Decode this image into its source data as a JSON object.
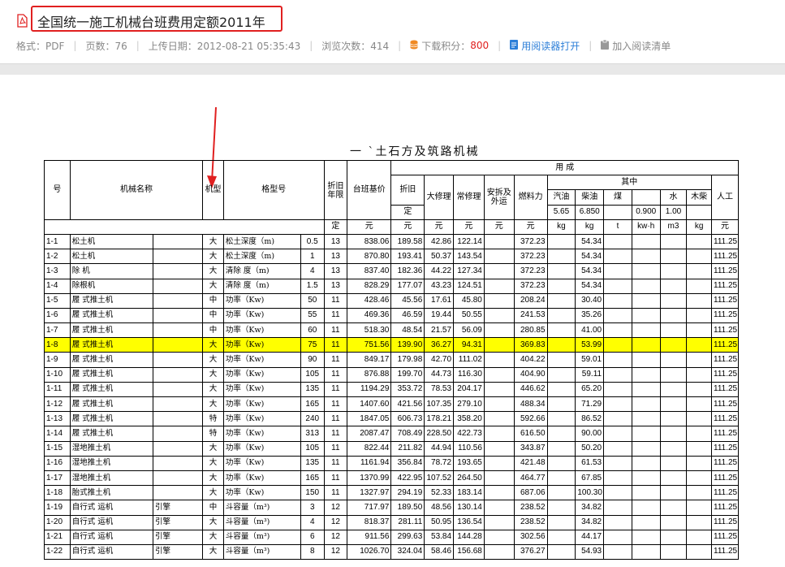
{
  "header": {
    "title": "全国统一施工机械台班费用定额2011年",
    "format": "格式：PDF",
    "pages": "页数：76",
    "upload": "上传日期：2012-08-21 05:35:43",
    "views": "浏览次数：414",
    "points_label": "下载积分：",
    "points_value": "800",
    "open_reader": "用阅读器打开",
    "add_list": "加入阅读清单",
    "accent": "#e02020"
  },
  "doc": {
    "title": "一 `土石方及筑路机械"
  },
  "table": {
    "h_no": "号",
    "h_name": "机械名称",
    "h_type": "机型",
    "h_model": "格型号",
    "h_life": "折旧年限",
    "h_life_unit": "定",
    "h_base": "台班基价",
    "h_use": "用 成",
    "h_dep": "折旧",
    "h_dep2": "定",
    "h_major": "大修理",
    "h_regular": "常修理",
    "h_install": "安拆及外运",
    "h_fuel": "燃料力",
    "h_among": "其中",
    "h_gas": "汽油",
    "h_diesel": "柴油",
    "h_coal": "煤",
    "h_water": "水",
    "h_wood": "木柴",
    "h_labor": "人工",
    "p_gas": "5.65",
    "p_diesel": "6.850",
    "p_elec": "0.900",
    "p_water": "1.00",
    "u_life": "定",
    "u_yuan": "元",
    "u_kg": "kg",
    "u_t": "t",
    "u_kwh": "kw·h",
    "u_m3": "m3",
    "rows": [
      {
        "no": "1-1",
        "name": "松土机",
        "sub": "",
        "type": "大",
        "spec": "松土深度（m)",
        "size": "0.5",
        "life": "13",
        "base": "838.06",
        "dep": "189.58",
        "major": "42.86",
        "reg": "122.14",
        "fuel": "372.23",
        "diesel": "54.34",
        "labor": "111.25"
      },
      {
        "no": "1-2",
        "name": "松土机",
        "sub": "",
        "type": "大",
        "spec": "松土深度（m)",
        "size": "1",
        "life": "13",
        "base": "870.80",
        "dep": "193.41",
        "major": "50.37",
        "reg": "143.54",
        "fuel": "372.23",
        "diesel": "54.34",
        "labor": "111.25"
      },
      {
        "no": "1-3",
        "name": "除 机",
        "sub": "",
        "type": "大",
        "spec": "清除 度（m)",
        "size": "4",
        "life": "13",
        "base": "837.40",
        "dep": "182.36",
        "major": "44.22",
        "reg": "127.34",
        "fuel": "372.23",
        "diesel": "54.34",
        "labor": "111.25"
      },
      {
        "no": "1-4",
        "name": "除根机",
        "sub": "",
        "type": "大",
        "spec": "清除 度（m)",
        "size": "1.5",
        "life": "13",
        "base": "828.29",
        "dep": "177.07",
        "major": "43.23",
        "reg": "124.51",
        "fuel": "372.23",
        "diesel": "54.34",
        "labor": "111.25"
      },
      {
        "no": "1-5",
        "name": "履 式推土机",
        "sub": "",
        "type": "中",
        "spec": "功率（Kw)",
        "size": "50",
        "life": "11",
        "base": "428.46",
        "dep": "45.56",
        "major": "17.61",
        "reg": "45.80",
        "fuel": "208.24",
        "diesel": "30.40",
        "labor": "111.25"
      },
      {
        "no": "1-6",
        "name": "履 式推土机",
        "sub": "",
        "type": "中",
        "spec": "功率（Kw)",
        "size": "55",
        "life": "11",
        "base": "469.36",
        "dep": "46.59",
        "major": "19.44",
        "reg": "50.55",
        "fuel": "241.53",
        "diesel": "35.26",
        "labor": "111.25"
      },
      {
        "no": "1-7",
        "name": "履 式推土机",
        "sub": "",
        "type": "中",
        "spec": "功率（Kw)",
        "size": "60",
        "life": "11",
        "base": "518.30",
        "dep": "48.54",
        "major": "21.57",
        "reg": "56.09",
        "fuel": "280.85",
        "diesel": "41.00",
        "labor": "111.25"
      },
      {
        "no": "1-8",
        "name": "履 式推土机",
        "sub": "",
        "type": "大",
        "spec": "功率（Kw)",
        "size": "75",
        "life": "11",
        "base": "751.56",
        "dep": "139.90",
        "major": "36.27",
        "reg": "94.31",
        "fuel": "369.83",
        "diesel": "53.99",
        "labor": "111.25",
        "hl": true
      },
      {
        "no": "1-9",
        "name": "履 式推土机",
        "sub": "",
        "type": "大",
        "spec": "功率（Kw)",
        "size": "90",
        "life": "11",
        "base": "849.17",
        "dep": "179.98",
        "major": "42.70",
        "reg": "111.02",
        "fuel": "404.22",
        "diesel": "59.01",
        "labor": "111.25"
      },
      {
        "no": "1-10",
        "name": "履 式推土机",
        "sub": "",
        "type": "大",
        "spec": "功率（Kw)",
        "size": "105",
        "life": "11",
        "base": "876.88",
        "dep": "199.70",
        "major": "44.73",
        "reg": "116.30",
        "fuel": "404.90",
        "diesel": "59.11",
        "labor": "111.25"
      },
      {
        "no": "1-11",
        "name": "履 式推土机",
        "sub": "",
        "type": "大",
        "spec": "功率（Kw)",
        "size": "135",
        "life": "11",
        "base": "1194.29",
        "dep": "353.72",
        "major": "78.53",
        "reg": "204.17",
        "fuel": "446.62",
        "diesel": "65.20",
        "labor": "111.25"
      },
      {
        "no": "1-12",
        "name": "履 式推土机",
        "sub": "",
        "type": "大",
        "spec": "功率（Kw)",
        "size": "165",
        "life": "11",
        "base": "1407.60",
        "dep": "421.56",
        "major": "107.35",
        "reg": "279.10",
        "fuel": "488.34",
        "diesel": "71.29",
        "labor": "111.25"
      },
      {
        "no": "1-13",
        "name": "履 式推土机",
        "sub": "",
        "type": "特",
        "spec": "功率（Kw)",
        "size": "240",
        "life": "11",
        "base": "1847.05",
        "dep": "606.73",
        "major": "178.21",
        "reg": "358.20",
        "fuel": "592.66",
        "diesel": "86.52",
        "labor": "111.25"
      },
      {
        "no": "1-14",
        "name": "履 式推土机",
        "sub": "",
        "type": "特",
        "spec": "功率（Kw)",
        "size": "313",
        "life": "11",
        "base": "2087.47",
        "dep": "708.49",
        "major": "228.50",
        "reg": "422.73",
        "fuel": "616.50",
        "diesel": "90.00",
        "labor": "111.25"
      },
      {
        "no": "1-15",
        "name": "湿地推土机",
        "sub": "",
        "type": "大",
        "spec": "功率（Kw)",
        "size": "105",
        "life": "11",
        "base": "822.44",
        "dep": "211.82",
        "major": "44.94",
        "reg": "110.56",
        "fuel": "343.87",
        "diesel": "50.20",
        "labor": "111.25"
      },
      {
        "no": "1-16",
        "name": "湿地推土机",
        "sub": "",
        "type": "大",
        "spec": "功率（Kw)",
        "size": "135",
        "life": "11",
        "base": "1161.94",
        "dep": "356.84",
        "major": "78.72",
        "reg": "193.65",
        "fuel": "421.48",
        "diesel": "61.53",
        "labor": "111.25"
      },
      {
        "no": "1-17",
        "name": "湿地推土机",
        "sub": "",
        "type": "大",
        "spec": "功率（Kw)",
        "size": "165",
        "life": "11",
        "base": "1370.99",
        "dep": "422.95",
        "major": "107.52",
        "reg": "264.50",
        "fuel": "464.77",
        "diesel": "67.85",
        "labor": "111.25"
      },
      {
        "no": "1-18",
        "name": "  胎式推土机",
        "sub": "",
        "type": "大",
        "spec": "功率（Kw)",
        "size": "150",
        "life": "11",
        "base": "1327.97",
        "dep": "294.19",
        "major": "52.33",
        "reg": "183.14",
        "fuel": "687.06",
        "diesel": "100.30",
        "labor": "111.25"
      },
      {
        "no": "1-19",
        "name": "自行式 运机",
        "sub": "引擎",
        "type": "中",
        "spec": "斗容量（m³)",
        "size": "3",
        "life": "12",
        "base": "717.97",
        "dep": "189.50",
        "major": "48.56",
        "reg": "130.14",
        "fuel": "238.52",
        "diesel": "34.82",
        "labor": "111.25"
      },
      {
        "no": "1-20",
        "name": "自行式 运机",
        "sub": "引擎",
        "type": "大",
        "spec": "斗容量（m³)",
        "size": "4",
        "life": "12",
        "base": "818.37",
        "dep": "281.11",
        "major": "50.95",
        "reg": "136.54",
        "fuel": "238.52",
        "diesel": "34.82",
        "labor": "111.25"
      },
      {
        "no": "1-21",
        "name": "自行式 运机",
        "sub": "引擎",
        "type": "大",
        "spec": "斗容量（m³)",
        "size": "6",
        "life": "12",
        "base": "911.56",
        "dep": "299.63",
        "major": "53.84",
        "reg": "144.28",
        "fuel": "302.56",
        "diesel": "44.17",
        "labor": "111.25"
      },
      {
        "no": "1-22",
        "name": "自行式 运机",
        "sub": "引擎",
        "type": "大",
        "spec": "斗容量（m³)",
        "size": "8",
        "life": "12",
        "base": "1026.70",
        "dep": "324.04",
        "major": "58.46",
        "reg": "156.68",
        "fuel": "376.27",
        "diesel": "54.93",
        "labor": "111.25"
      }
    ]
  }
}
